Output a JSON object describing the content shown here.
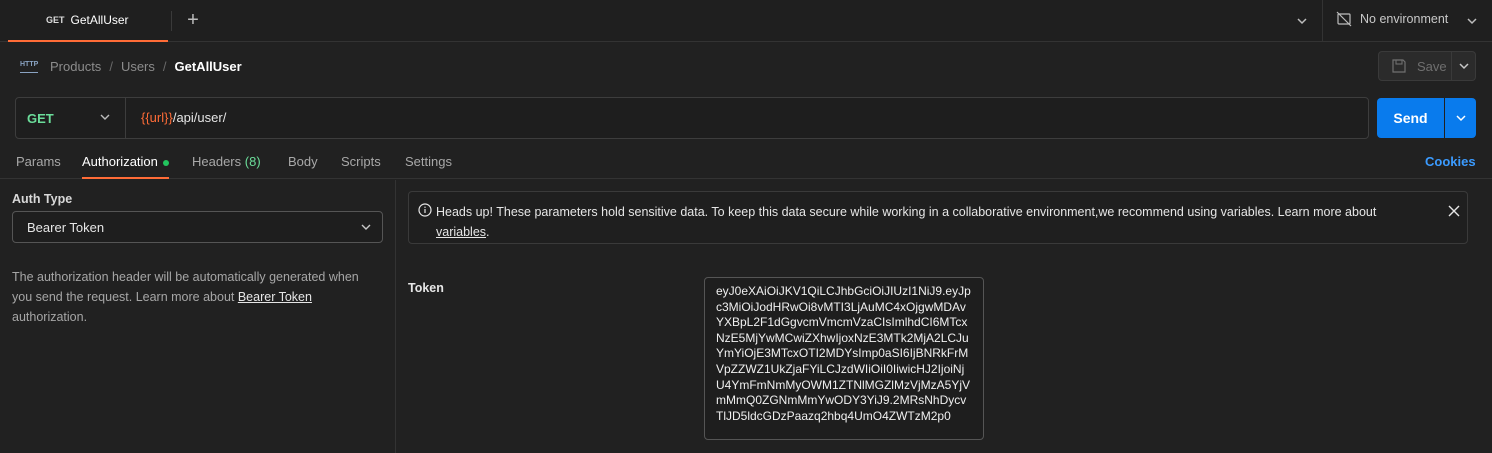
{
  "tabbar": {
    "tab": {
      "method": "GET",
      "name": "GetAllUser"
    },
    "new_tab_icon": "plus-icon",
    "environment": {
      "label": "No environment",
      "icon": "no-environment-icon"
    }
  },
  "breadcrumb": {
    "icon_text": "HTTP",
    "items": [
      "Products",
      "Users"
    ],
    "current": "GetAllUser"
  },
  "save": {
    "label": "Save"
  },
  "request": {
    "method": "GET",
    "url_var": "{{url}}",
    "url_path": "/api/user/"
  },
  "send": {
    "label": "Send"
  },
  "subtabs": {
    "params": "Params",
    "authorization": "Authorization",
    "headers": "Headers",
    "headers_count": "(8)",
    "body": "Body",
    "scripts": "Scripts",
    "settings": "Settings",
    "cookies": "Cookies"
  },
  "auth": {
    "type_label": "Auth Type",
    "type_value": "Bearer Token",
    "desc_pre": "The authorization header will be automatically generated when you send the request. Learn more about ",
    "desc_link": "Bearer Token",
    "desc_post": " authorization."
  },
  "alert": {
    "text": "Heads up! These parameters hold sensitive data. To keep this data secure while working in a collaborative environment,we recommend using variables. Learn more about ",
    "link": "variables",
    "end": "."
  },
  "token": {
    "label": "Token",
    "value": "eyJ0eXAiOiJKV1QiLCJhbGciOiJIUzI1NiJ9.eyJpc3MiOiJodHRwOi8vMTI3LjAuMC4xOjgwMDAvYXBpL2F1dGgvcmVmcmVzaCIsImlhdCI6MTcxNzE5MjYwMCwiZXhwIjoxNzE3MTk2MjA2LCJuYmYiOjE3MTcxOTI2MDYsImp0aSI6IjBNRkFrMVpZZWZ1UkZjaFYiLCJzdWIiOiI0IiwicHJ2IjoiNjU4YmFmNmMyOWM1ZTNlMGZlMzVjMzA5YjVmMmQ0ZGNmMmYwODY3YiJ9.2MRsNhDycvTlJD5ldcGDzPaazq2hbq4UmO4ZWTzM2p0"
  }
}
